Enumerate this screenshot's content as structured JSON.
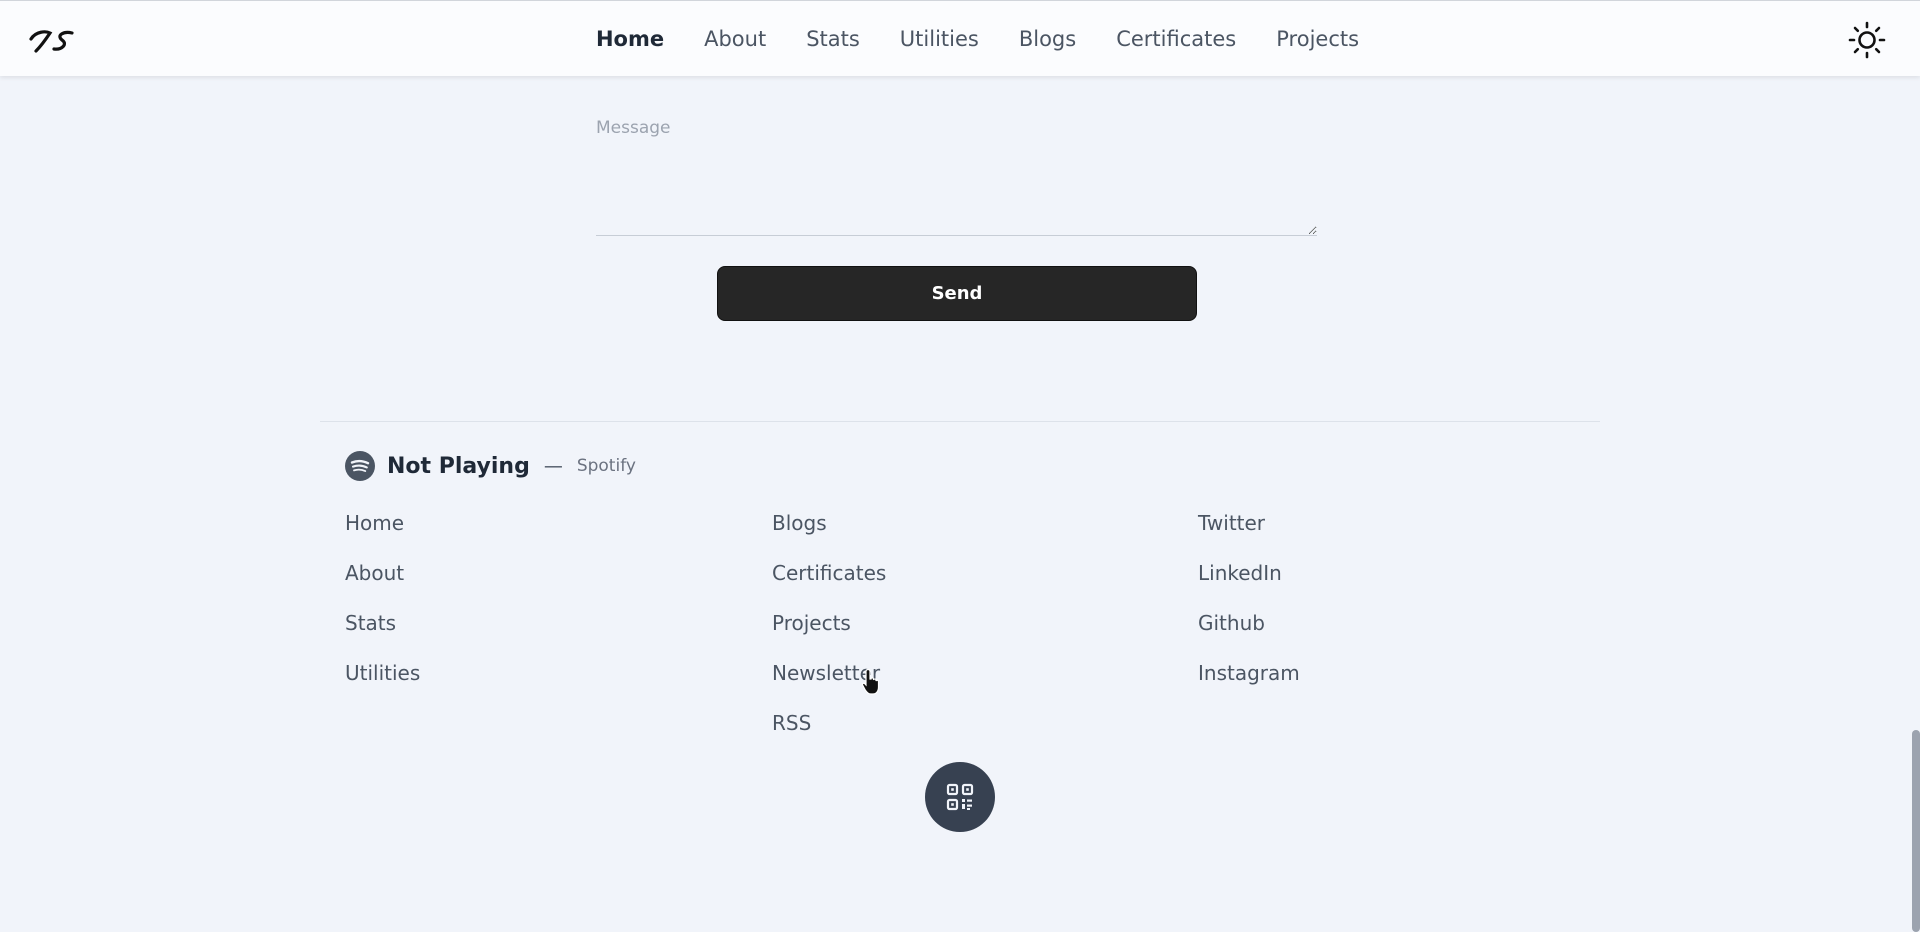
{
  "header": {
    "logo_alt": "JS",
    "nav": [
      {
        "label": "Home",
        "active": true
      },
      {
        "label": "About"
      },
      {
        "label": "Stats"
      },
      {
        "label": "Utilities"
      },
      {
        "label": "Blogs"
      },
      {
        "label": "Certificates"
      },
      {
        "label": "Projects"
      }
    ],
    "theme_icon": "sun-icon"
  },
  "form": {
    "message_placeholder": "Message",
    "message_value": "",
    "send_label": "Send"
  },
  "footer": {
    "now_playing": {
      "icon": "spotify-icon",
      "status": "Not Playing",
      "dash": "—",
      "source": "Spotify"
    },
    "columns": [
      [
        "Home",
        "About",
        "Stats",
        "Utilities"
      ],
      [
        "Blogs",
        "Certificates",
        "Projects",
        "Newsletter",
        "RSS"
      ],
      [
        "Twitter",
        "LinkedIn",
        "Github",
        "Instagram"
      ]
    ],
    "qr_icon": "qr-code-icon"
  },
  "colors": {
    "background": "#f1f4fa",
    "button": "#262626",
    "qr_button": "#374151"
  }
}
